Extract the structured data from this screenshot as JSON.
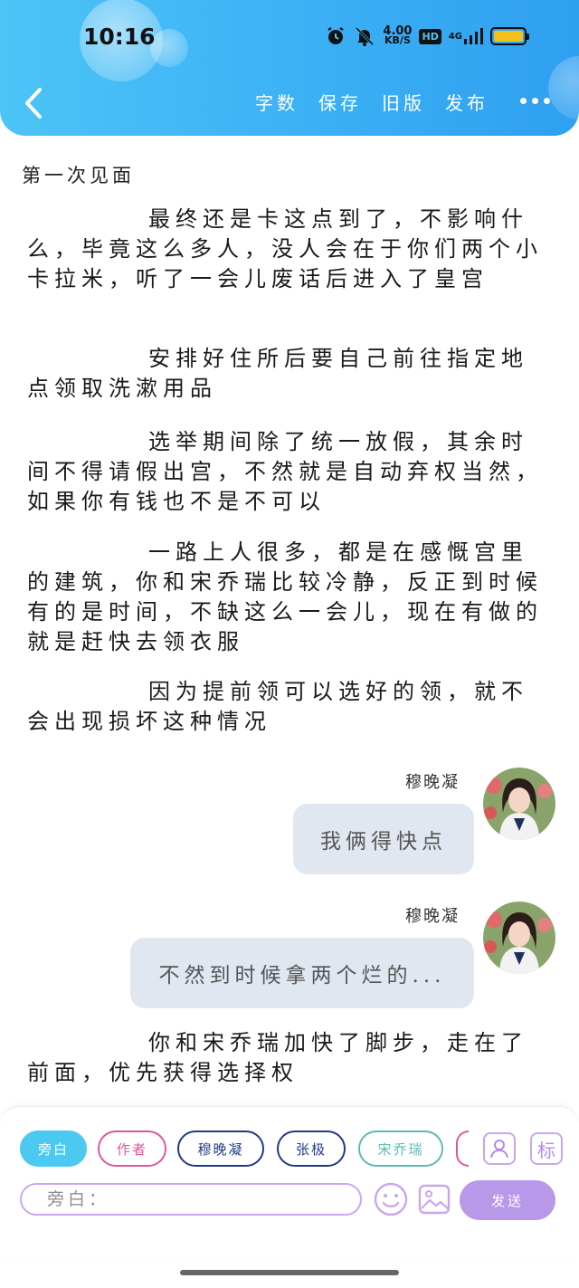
{
  "status_bar": {
    "time": "10:16",
    "net_speed_value": "4.00",
    "net_speed_unit": "KB/S",
    "hd": "HD",
    "signal": "4G"
  },
  "header": {
    "actions": [
      "字数",
      "保存",
      "旧版",
      "发布"
    ],
    "colors": {
      "gradient_start": "#4dc4f6",
      "gradient_end": "#2f9ff0"
    }
  },
  "chapter_title": "第一次见面",
  "paragraphs": {
    "p1": "最终还是卡这点到了，不影响什么，毕竟这么多人，没人会在于你们两个小卡拉米，听了一会儿废话后进入了皇宫",
    "p2": "安排好住所后要自己前往指定地点领取洗漱用品",
    "p3": "选举期间除了统一放假，其余时间不得请假出宫，不然就是自动弃权当然，如果你有钱也不是不可以",
    "p4": "一路上人很多，都是在感慨宫里的建筑，你和宋乔瑞比较冷静，反正到时候有的是时间，不缺这么一会儿，现在有做的就是赶快去领衣服",
    "p5": "因为提前领可以选好的领，就不会出现损坏这种情况",
    "p6": "你和宋乔瑞加快了脚步，走在了前面，优先获得选择权"
  },
  "messages": [
    {
      "speaker": "穆晚凝",
      "text": "我俩得快点"
    },
    {
      "speaker": "穆晚凝",
      "text": "不然到时候拿两个烂的..."
    }
  ],
  "composer": {
    "roles": [
      "旁白",
      "作者",
      "穆晚凝",
      "张极",
      "宋乔瑞"
    ],
    "input_placeholder": "旁白：",
    "send_label": "发送",
    "tag_label": "标",
    "colors": {
      "accent": "#b898e8",
      "narrator": "#4cc9f0",
      "author": "#e0569a",
      "navy": "#1f3b86",
      "teal": "#5fb8b0"
    }
  }
}
